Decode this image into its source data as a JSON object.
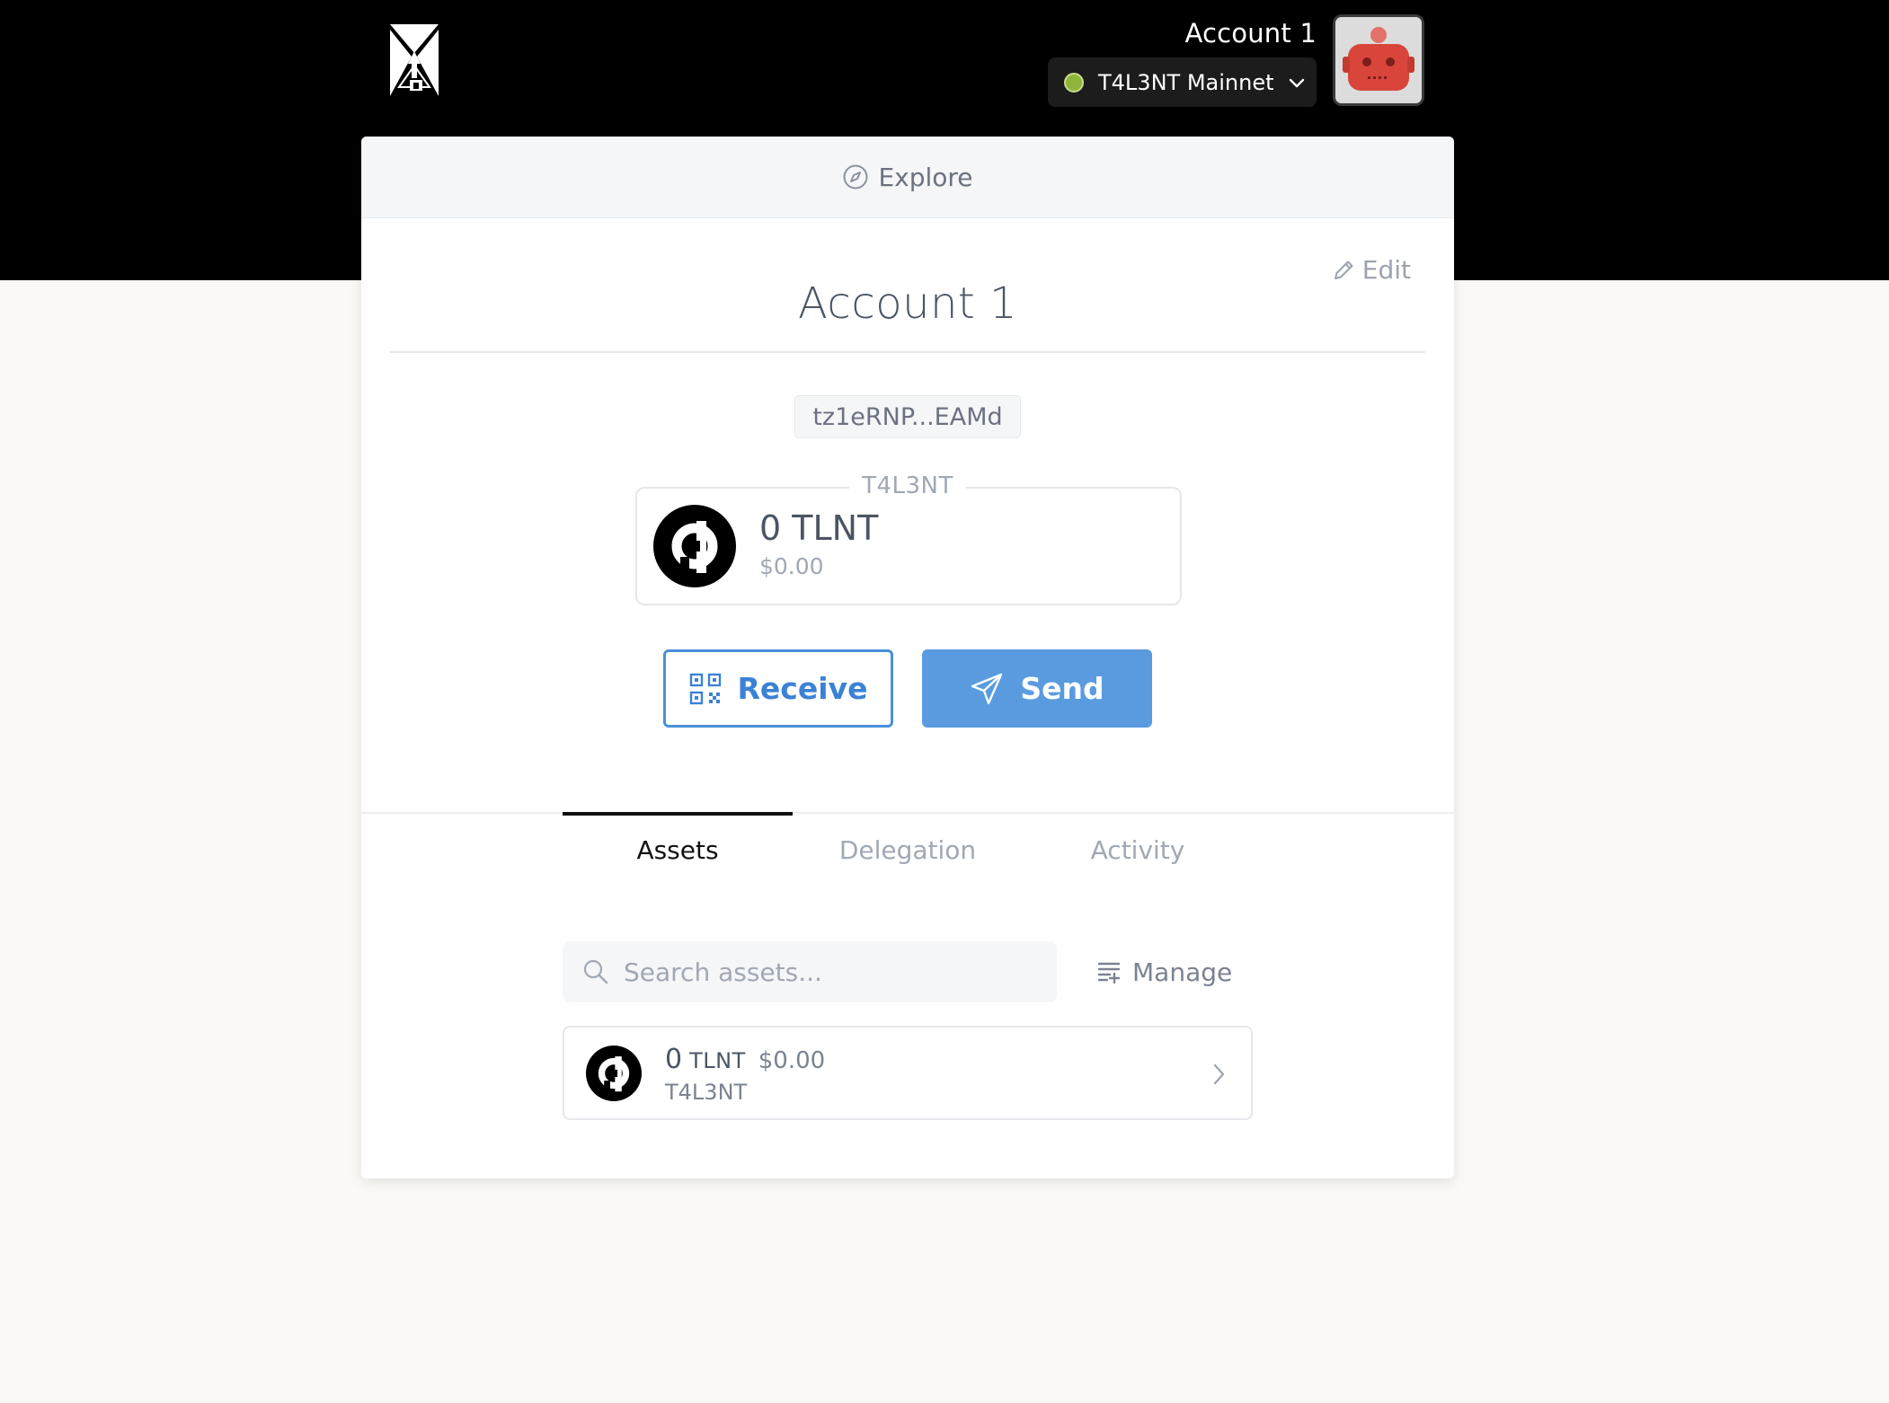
{
  "header": {
    "account_name": "Account 1",
    "network_label": "T4L3NT Mainnet",
    "network_status_color": "#8fb43a"
  },
  "explore": {
    "label": "Explore"
  },
  "account": {
    "edit_label": "Edit",
    "title": "Account 1",
    "address_short": "tz1eRNP...EAMd"
  },
  "balance": {
    "network_legend": "T4L3NT",
    "amount": "0",
    "symbol": "TLNT",
    "fiat": "$0.00"
  },
  "actions": {
    "receive_label": "Receive",
    "send_label": "Send",
    "accent_color": "#4a90d9"
  },
  "tabs": [
    {
      "label": "Assets",
      "active": true
    },
    {
      "label": "Delegation",
      "active": false
    },
    {
      "label": "Activity",
      "active": false
    }
  ],
  "assets": {
    "search_placeholder": "Search assets...",
    "manage_label": "Manage",
    "items": [
      {
        "amount": "0",
        "symbol": "TLNT",
        "fiat": "$0.00",
        "name": "T4L3NT"
      }
    ]
  },
  "icons": {
    "logo": "temple-logo-icon",
    "network_chevron": "chevron-down-icon",
    "avatar": "robot-avatar-icon",
    "explore": "compass-icon",
    "edit": "pencil-icon",
    "receive": "qr-code-icon",
    "send": "paper-plane-icon",
    "search": "search-icon",
    "manage": "list-settings-icon",
    "asset_row": "chevron-right-icon",
    "token": "tlnt-token-icon"
  }
}
